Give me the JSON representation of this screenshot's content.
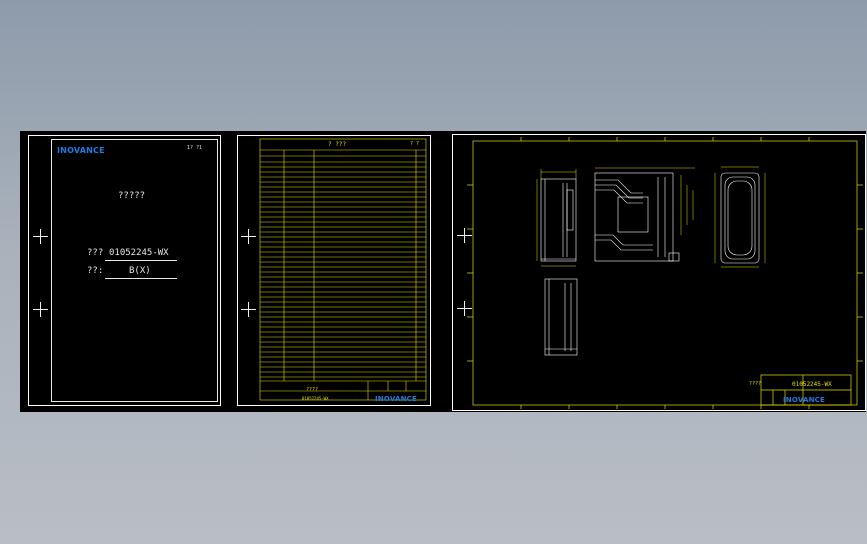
{
  "colors": {
    "background_top": "#8e9bab",
    "background_bottom": "#b9bec5",
    "viewport": "#000000",
    "line_white": "#ffffff",
    "line_yellow": "#e8e000",
    "brand_blue": "#1e7be0"
  },
  "cover_sheet": {
    "logo": "INOVANCE",
    "page_mark": "1? ?1",
    "title": "?????",
    "drawing_no_label": "???",
    "drawing_no_value": "01052245-WX",
    "version_label": "??:",
    "version_value": "B(X)"
  },
  "change_record_sheet": {
    "title": "? ???",
    "page_mark": "? ?",
    "footer_title": "????",
    "footer_code": "01052245-WX",
    "logo": "INOVANCE"
  },
  "drawing_sheet": {
    "title_block": {
      "name_label": "????",
      "drawing_no": "01052245-WX",
      "logo": "INOVANCE"
    }
  },
  "icons": [
    "crosshair-icon"
  ]
}
